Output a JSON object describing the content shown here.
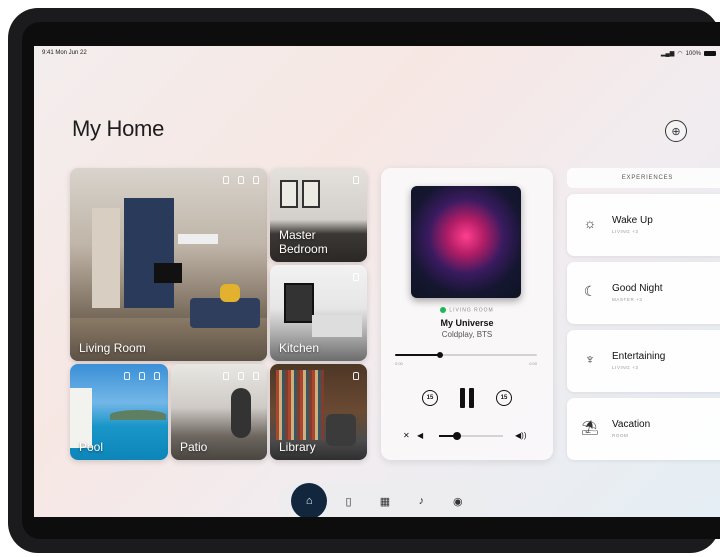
{
  "status": {
    "time": "9:41 Mon Jun 22",
    "battery": "100%"
  },
  "header": {
    "title": "My Home"
  },
  "rooms": {
    "living": "Living Room",
    "master": "Master Bedroom",
    "kitchen": "Kitchen",
    "pool": "Pool",
    "patio": "Patio",
    "library": "Library"
  },
  "player": {
    "room": "LIVING ROOM",
    "song": "My Universe",
    "artist": "Coldplay, BTS",
    "time_start": "0:00",
    "time_end": "0:00",
    "progress": 0.32,
    "volume": 0.28,
    "skip_back": "15",
    "skip_fwd": "15"
  },
  "experiences": {
    "header": "EXPERIENCES",
    "items": [
      {
        "title": "Wake Up",
        "sub": "LIVING +3",
        "icon": "sun-icon"
      },
      {
        "title": "Good Night",
        "sub": "MASTER +3",
        "icon": "moon-stars-icon"
      },
      {
        "title": "Entertaining",
        "sub": "LIVING +3",
        "icon": "drinks-icon"
      },
      {
        "title": "Vacation",
        "sub": "ROOM",
        "icon": "beach-icon"
      }
    ]
  },
  "tabs": [
    "home-icon",
    "door-icon",
    "devices-icon",
    "bell-icon",
    "profile-icon"
  ]
}
